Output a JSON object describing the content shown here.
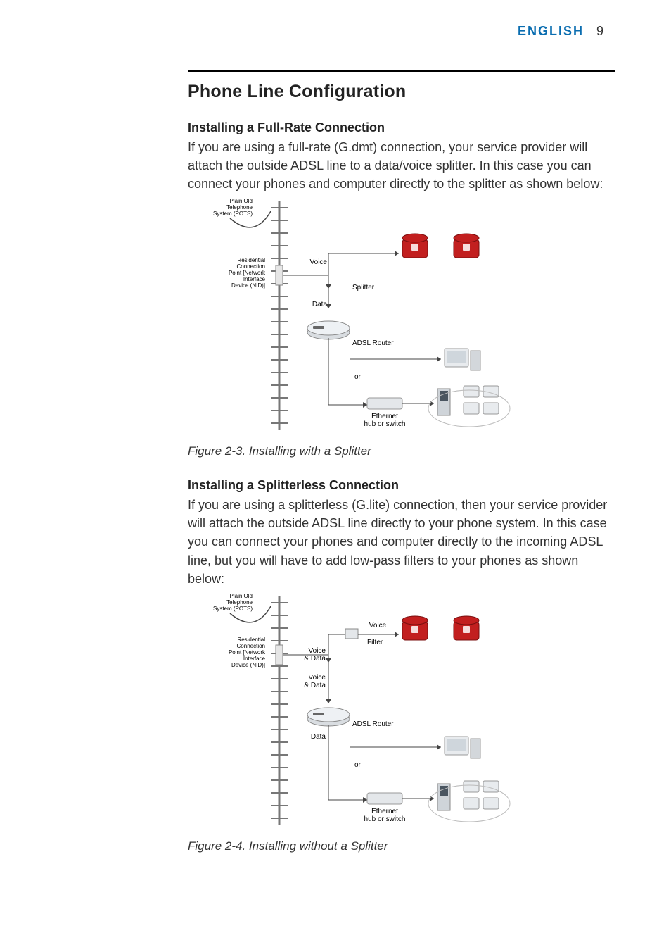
{
  "header": {
    "language": "ENGLISH",
    "page_number": "9"
  },
  "section_title": "Phone Line Configuration",
  "sect1": {
    "heading": "Installing a Full-Rate Connection",
    "paragraph": "If you are using a full-rate (G.dmt) connection, your service provider will attach the outside ADSL line to a data/voice splitter. In this case you can connect your phones and computer directly to the splitter as shown below:",
    "figure_caption": "Figure 2-3. Installing with a Splitter",
    "diagram": {
      "pots": "Plain Old Telephone System (POTS)",
      "nid": "Residential Connection Point [Network Interface Device (NID)]",
      "voice": "Voice",
      "splitter": "Splitter",
      "data": "Data",
      "adsl_router": "ADSL Router",
      "or": "or",
      "ethernet": "Ethernet hub or switch"
    }
  },
  "sect2": {
    "heading": "Installing a Splitterless Connection",
    "paragraph": "If you are using a splitterless (G.lite) connection, then your service provider will attach the outside ADSL line directly to your phone system. In this case you can connect your phones and computer directly to the incoming ADSL line, but you will have to add low-pass filters to your phones as shown below:",
    "figure_caption": "Figure 2-4. Installing without a Splitter",
    "diagram": {
      "pots": "Plain Old Telephone System (POTS)",
      "nid": "Residential Connection Point [Network Interface Device (NID)]",
      "voice": "Voice",
      "filter": "Filter",
      "voice_data": "Voice & Data",
      "adsl_router": "ADSL Router",
      "data": "Data",
      "or": "or",
      "ethernet": "Ethernet hub or switch"
    }
  }
}
